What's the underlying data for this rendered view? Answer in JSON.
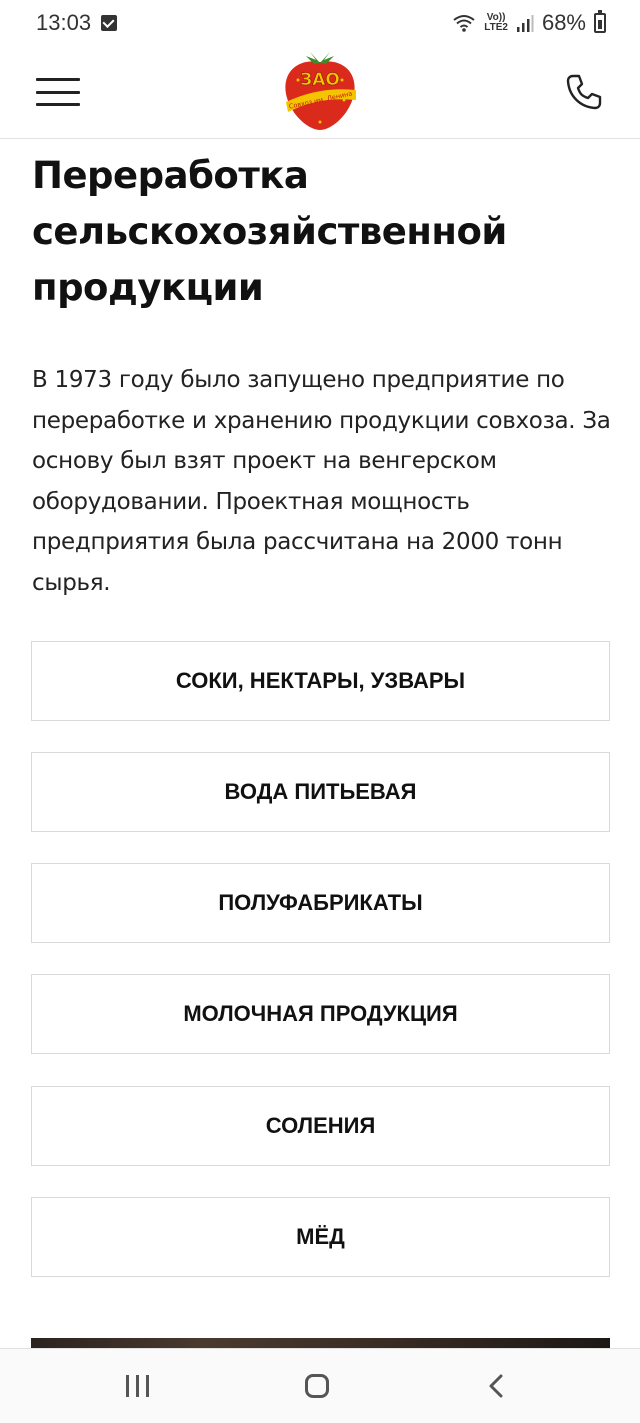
{
  "status_bar": {
    "time": "13:03",
    "network_top": "Vo))",
    "network_bottom": "LTE2",
    "battery": "68%",
    "icons": [
      "checkbox-notification-icon",
      "wifi-icon",
      "signal-icon",
      "battery-icon"
    ]
  },
  "header": {
    "logo_text": "ЗАО",
    "logo_subtitle": "Совхоз им. Ленина",
    "icons": [
      "hamburger-menu-icon",
      "phone-icon"
    ]
  },
  "page": {
    "title": "Переработка сельскохозяйственной продукции",
    "lead": "В 1973 году было запущено предприятие по переработке и хранению продукции совхоза. За основу был взят проект на венгерском оборудовании. Проектная мощность предприятия была рассчитана на 2000 тонн сырья."
  },
  "categories": [
    {
      "label": "СОКИ, НЕКТАРЫ, УЗВАРЫ"
    },
    {
      "label": "ВОДА ПИТЬЕВАЯ"
    },
    {
      "label": "ПОЛУФАБРИКАТЫ"
    },
    {
      "label": "МОЛОЧНАЯ ПРОДУКЦИЯ"
    },
    {
      "label": "СОЛЕНИЯ"
    },
    {
      "label": "МЁД"
    }
  ],
  "colors": {
    "logo_red": "#d92a1c",
    "logo_yellow": "#f5c400",
    "logo_green": "#3d8a2a",
    "text": "#111111",
    "border": "#d9d9d9"
  }
}
